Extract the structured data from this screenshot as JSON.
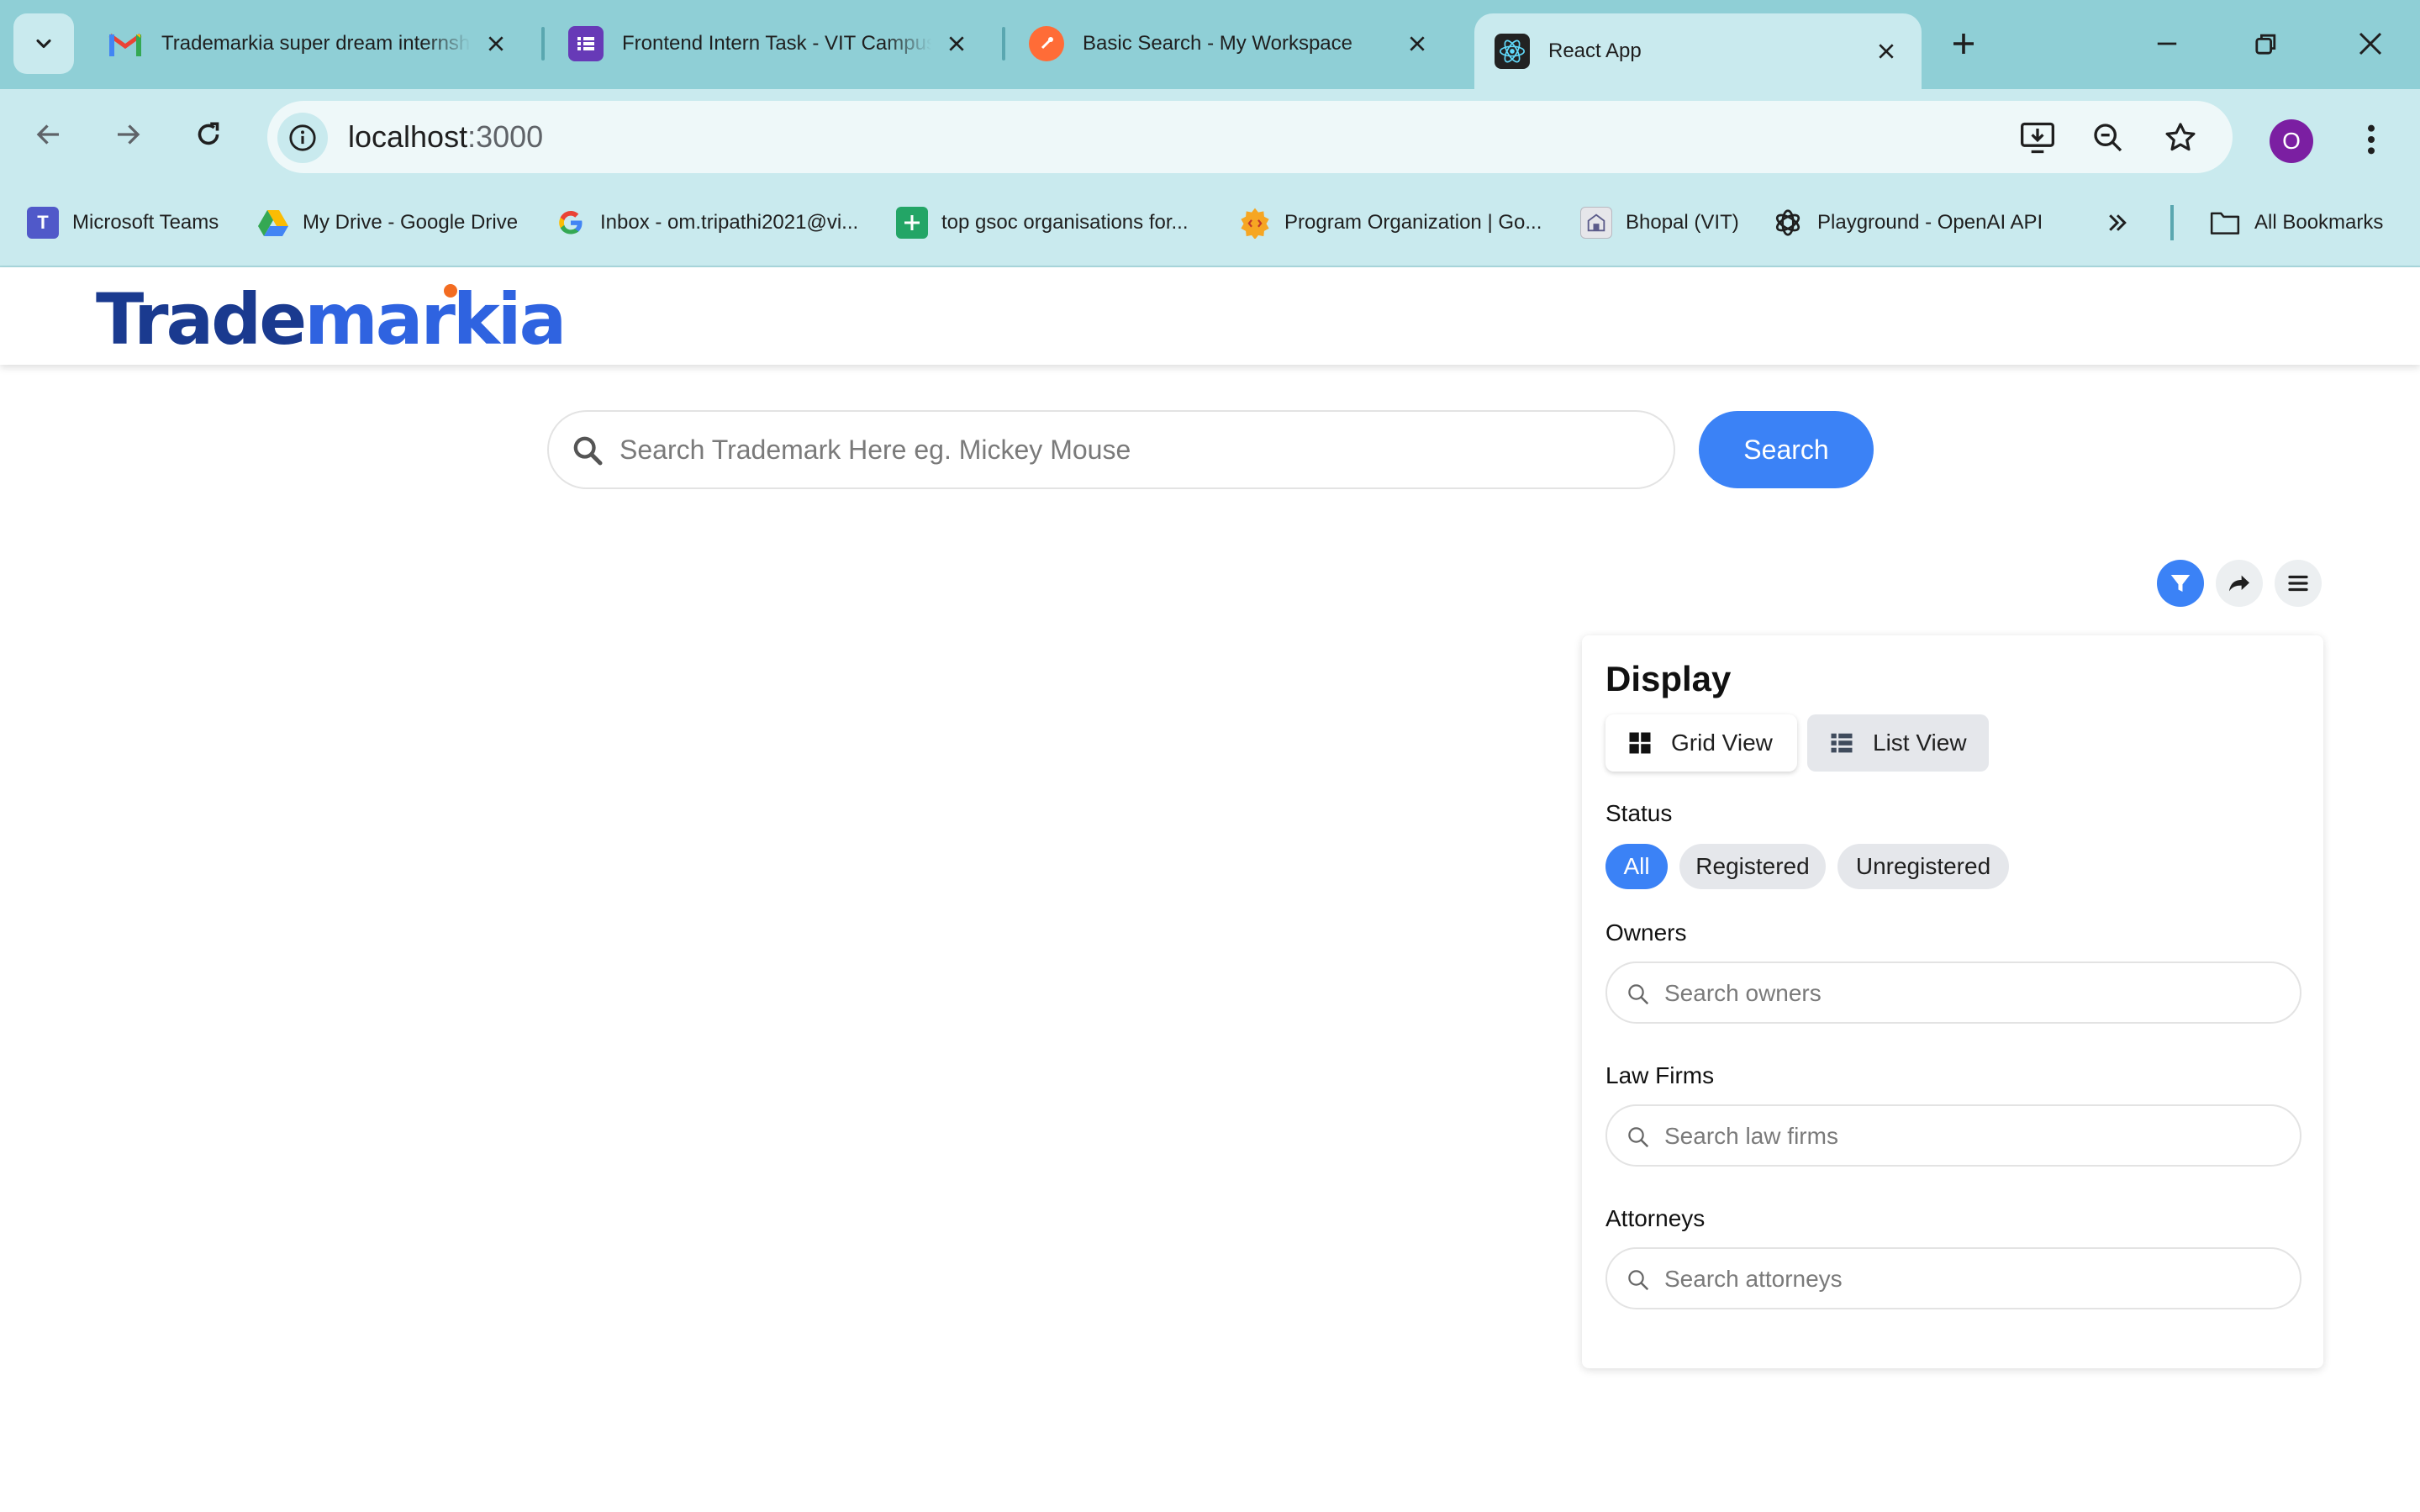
{
  "browser": {
    "tabs": [
      {
        "title": "Trademarkia super dream internship",
        "favicon": "gmail-icon"
      },
      {
        "title": "Frontend Intern Task - VIT Campus",
        "favicon": "google-forms-icon"
      },
      {
        "title": "Basic Search - My Workspace",
        "favicon": "postman-icon"
      },
      {
        "title": "React App",
        "favicon": "react-icon",
        "active": true
      }
    ],
    "url_host": "localhost",
    "url_port": ":3000",
    "profile_initial": "O",
    "bookmarks": [
      {
        "label": "Microsoft Teams",
        "icon": "teams-icon"
      },
      {
        "label": "My Drive - Google Drive",
        "icon": "google-drive-icon"
      },
      {
        "label": "Inbox - om.tripathi2021@vi...",
        "icon": "google-icon"
      },
      {
        "label": "top gsoc organisations for...",
        "icon": "google-sheets-icon"
      },
      {
        "label": "Program Organization | Go...",
        "icon": "gsoc-icon"
      },
      {
        "label": "Bhopal (VIT)",
        "icon": "vit-icon"
      },
      {
        "label": "Playground - OpenAI API",
        "icon": "openai-icon"
      }
    ],
    "all_bookmarks": "All Bookmarks"
  },
  "app": {
    "logo_part1": "Trade",
    "logo_part2": "markia",
    "search": {
      "placeholder": "Search Trademark Here eg. Mickey Mouse",
      "button": "Search"
    },
    "filter_panel": {
      "title": "Display",
      "grid_view": "Grid View",
      "list_view": "List View",
      "status_label": "Status",
      "status_options": [
        "All",
        "Registered",
        "Unregistered"
      ],
      "selected_status": "All",
      "owners_label": "Owners",
      "owners_placeholder": "Search owners",
      "law_firms_label": "Law Firms",
      "law_firms_placeholder": "Search law firms",
      "attorneys_label": "Attorneys",
      "attorneys_placeholder": "Search attorneys"
    }
  },
  "colors": {
    "accent": "#3b82f6",
    "chrome_tabstrip": "#8fcfd6",
    "chrome_toolbar": "#c9eaee",
    "logo_dark": "#1a3a8f",
    "logo_light": "#2f63e0",
    "logo_dot": "#f36c21"
  }
}
